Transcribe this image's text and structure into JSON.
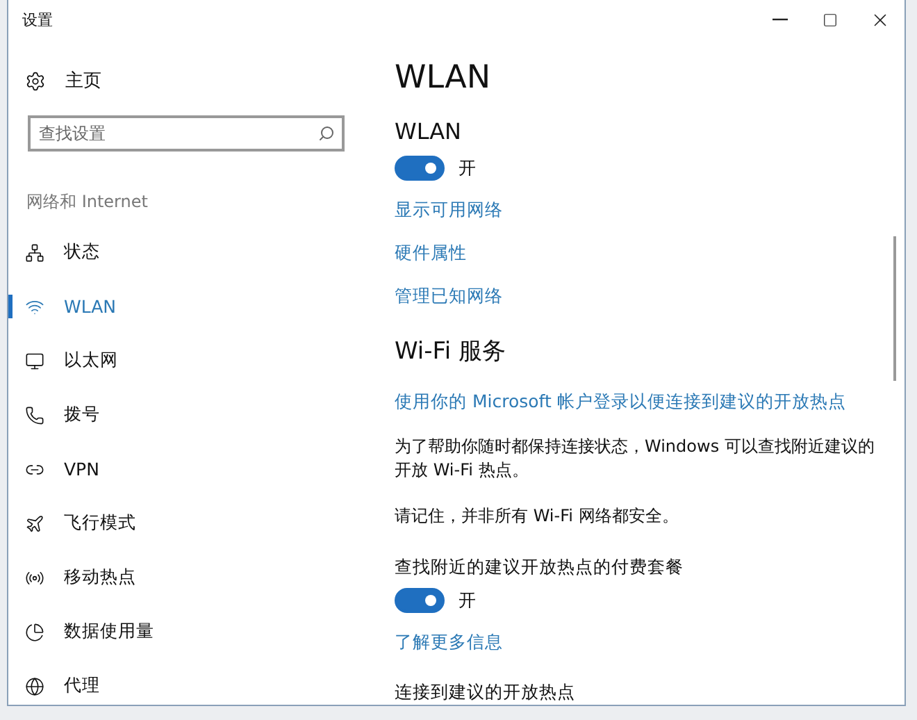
{
  "window": {
    "title": "设置"
  },
  "sidebar": {
    "home": {
      "label": "主页"
    },
    "search": {
      "placeholder": "查找设置"
    },
    "section": "网络和 Internet",
    "items": [
      {
        "kind": "status",
        "label": "状态",
        "selected": false
      },
      {
        "kind": "wifi",
        "label": "WLAN",
        "selected": true
      },
      {
        "kind": "ethernet",
        "label": "以太网",
        "selected": false
      },
      {
        "kind": "dialup",
        "label": "拨号",
        "selected": false
      },
      {
        "kind": "vpn",
        "label": "VPN",
        "selected": false
      },
      {
        "kind": "airplane",
        "label": "飞行模式",
        "selected": false
      },
      {
        "kind": "hotspot",
        "label": "移动热点",
        "selected": false
      },
      {
        "kind": "data",
        "label": "数据使用量",
        "selected": false
      },
      {
        "kind": "proxy",
        "label": "代理",
        "selected": false
      }
    ]
  },
  "content": [
    {
      "kind": "title",
      "text": "WLAN"
    },
    {
      "kind": "label",
      "text": "WLAN"
    },
    {
      "kind": "toggle",
      "on": true,
      "text": "开"
    },
    {
      "kind": "link",
      "text": "显示可用网络"
    },
    {
      "kind": "link",
      "text": "硬件属性"
    },
    {
      "kind": "link",
      "text": "管理已知网络"
    },
    {
      "kind": "heading",
      "text": "Wi-Fi 服务"
    },
    {
      "kind": "link",
      "text": "使用你的 Microsoft 帐户登录以便连接到建议的开放热点"
    },
    {
      "kind": "paragraph",
      "text": "为了帮助你随时都保持连接状态，Windows 可以查找附近建议的开放 Wi-Fi 热点。"
    },
    {
      "kind": "paragraph",
      "text": "请记住，并非所有 Wi-Fi 网络都安全。"
    },
    {
      "kind": "label",
      "text": "查找附近的建议开放热点的付费套餐"
    },
    {
      "kind": "toggle",
      "on": true,
      "text": "开"
    },
    {
      "kind": "link",
      "text": "了解更多信息"
    },
    {
      "kind": "label",
      "text": "连接到建议的开放热点"
    }
  ]
}
